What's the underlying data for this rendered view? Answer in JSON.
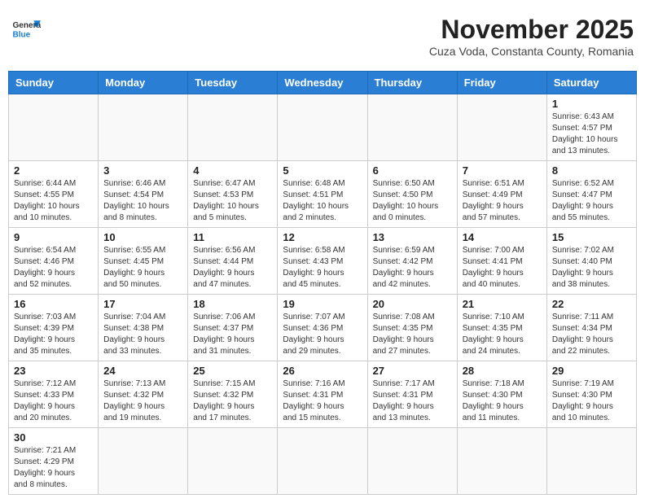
{
  "header": {
    "logo_line1": "General",
    "logo_line2": "Blue",
    "title": "November 2025",
    "subtitle": "Cuza Voda, Constanta County, Romania"
  },
  "weekdays": [
    "Sunday",
    "Monday",
    "Tuesday",
    "Wednesday",
    "Thursday",
    "Friday",
    "Saturday"
  ],
  "weeks": [
    [
      {
        "day": "",
        "info": ""
      },
      {
        "day": "",
        "info": ""
      },
      {
        "day": "",
        "info": ""
      },
      {
        "day": "",
        "info": ""
      },
      {
        "day": "",
        "info": ""
      },
      {
        "day": "",
        "info": ""
      },
      {
        "day": "1",
        "info": "Sunrise: 6:43 AM\nSunset: 4:57 PM\nDaylight: 10 hours\nand 13 minutes."
      }
    ],
    [
      {
        "day": "2",
        "info": "Sunrise: 6:44 AM\nSunset: 4:55 PM\nDaylight: 10 hours\nand 10 minutes."
      },
      {
        "day": "3",
        "info": "Sunrise: 6:46 AM\nSunset: 4:54 PM\nDaylight: 10 hours\nand 8 minutes."
      },
      {
        "day": "4",
        "info": "Sunrise: 6:47 AM\nSunset: 4:53 PM\nDaylight: 10 hours\nand 5 minutes."
      },
      {
        "day": "5",
        "info": "Sunrise: 6:48 AM\nSunset: 4:51 PM\nDaylight: 10 hours\nand 2 minutes."
      },
      {
        "day": "6",
        "info": "Sunrise: 6:50 AM\nSunset: 4:50 PM\nDaylight: 10 hours\nand 0 minutes."
      },
      {
        "day": "7",
        "info": "Sunrise: 6:51 AM\nSunset: 4:49 PM\nDaylight: 9 hours\nand 57 minutes."
      },
      {
        "day": "8",
        "info": "Sunrise: 6:52 AM\nSunset: 4:47 PM\nDaylight: 9 hours\nand 55 minutes."
      }
    ],
    [
      {
        "day": "9",
        "info": "Sunrise: 6:54 AM\nSunset: 4:46 PM\nDaylight: 9 hours\nand 52 minutes."
      },
      {
        "day": "10",
        "info": "Sunrise: 6:55 AM\nSunset: 4:45 PM\nDaylight: 9 hours\nand 50 minutes."
      },
      {
        "day": "11",
        "info": "Sunrise: 6:56 AM\nSunset: 4:44 PM\nDaylight: 9 hours\nand 47 minutes."
      },
      {
        "day": "12",
        "info": "Sunrise: 6:58 AM\nSunset: 4:43 PM\nDaylight: 9 hours\nand 45 minutes."
      },
      {
        "day": "13",
        "info": "Sunrise: 6:59 AM\nSunset: 4:42 PM\nDaylight: 9 hours\nand 42 minutes."
      },
      {
        "day": "14",
        "info": "Sunrise: 7:00 AM\nSunset: 4:41 PM\nDaylight: 9 hours\nand 40 minutes."
      },
      {
        "day": "15",
        "info": "Sunrise: 7:02 AM\nSunset: 4:40 PM\nDaylight: 9 hours\nand 38 minutes."
      }
    ],
    [
      {
        "day": "16",
        "info": "Sunrise: 7:03 AM\nSunset: 4:39 PM\nDaylight: 9 hours\nand 35 minutes."
      },
      {
        "day": "17",
        "info": "Sunrise: 7:04 AM\nSunset: 4:38 PM\nDaylight: 9 hours\nand 33 minutes."
      },
      {
        "day": "18",
        "info": "Sunrise: 7:06 AM\nSunset: 4:37 PM\nDaylight: 9 hours\nand 31 minutes."
      },
      {
        "day": "19",
        "info": "Sunrise: 7:07 AM\nSunset: 4:36 PM\nDaylight: 9 hours\nand 29 minutes."
      },
      {
        "day": "20",
        "info": "Sunrise: 7:08 AM\nSunset: 4:35 PM\nDaylight: 9 hours\nand 27 minutes."
      },
      {
        "day": "21",
        "info": "Sunrise: 7:10 AM\nSunset: 4:35 PM\nDaylight: 9 hours\nand 24 minutes."
      },
      {
        "day": "22",
        "info": "Sunrise: 7:11 AM\nSunset: 4:34 PM\nDaylight: 9 hours\nand 22 minutes."
      }
    ],
    [
      {
        "day": "23",
        "info": "Sunrise: 7:12 AM\nSunset: 4:33 PM\nDaylight: 9 hours\nand 20 minutes."
      },
      {
        "day": "24",
        "info": "Sunrise: 7:13 AM\nSunset: 4:32 PM\nDaylight: 9 hours\nand 19 minutes."
      },
      {
        "day": "25",
        "info": "Sunrise: 7:15 AM\nSunset: 4:32 PM\nDaylight: 9 hours\nand 17 minutes."
      },
      {
        "day": "26",
        "info": "Sunrise: 7:16 AM\nSunset: 4:31 PM\nDaylight: 9 hours\nand 15 minutes."
      },
      {
        "day": "27",
        "info": "Sunrise: 7:17 AM\nSunset: 4:31 PM\nDaylight: 9 hours\nand 13 minutes."
      },
      {
        "day": "28",
        "info": "Sunrise: 7:18 AM\nSunset: 4:30 PM\nDaylight: 9 hours\nand 11 minutes."
      },
      {
        "day": "29",
        "info": "Sunrise: 7:19 AM\nSunset: 4:30 PM\nDaylight: 9 hours\nand 10 minutes."
      }
    ],
    [
      {
        "day": "30",
        "info": "Sunrise: 7:21 AM\nSunset: 4:29 PM\nDaylight: 9 hours\nand 8 minutes."
      },
      {
        "day": "",
        "info": ""
      },
      {
        "day": "",
        "info": ""
      },
      {
        "day": "",
        "info": ""
      },
      {
        "day": "",
        "info": ""
      },
      {
        "day": "",
        "info": ""
      },
      {
        "day": "",
        "info": ""
      }
    ]
  ]
}
